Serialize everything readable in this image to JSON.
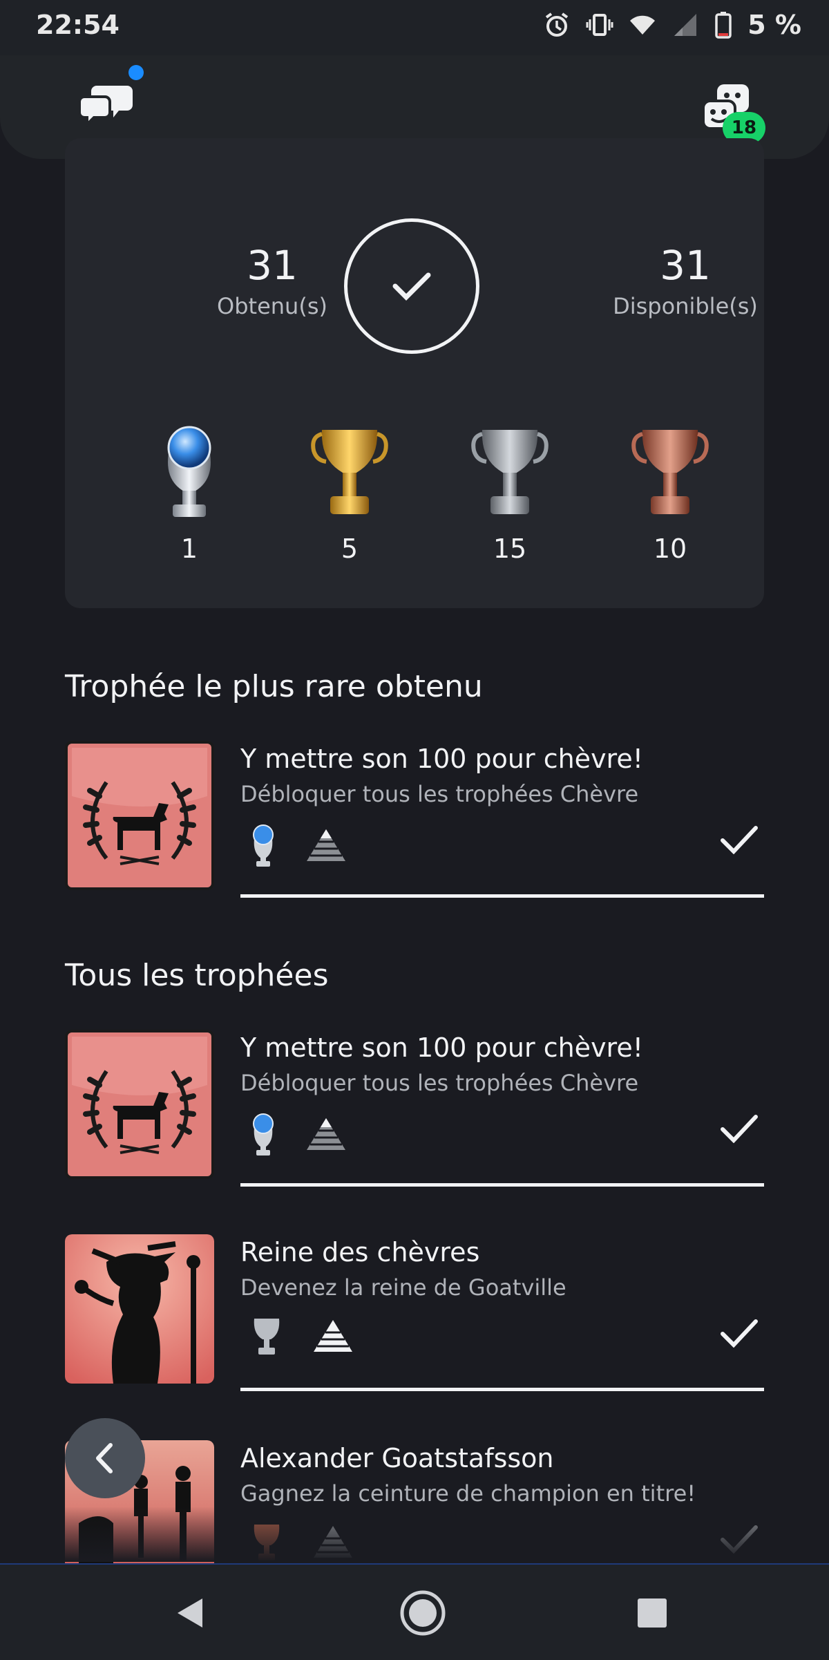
{
  "status_bar": {
    "time": "22:54",
    "battery_percent": "5 %"
  },
  "top_bar": {
    "friends_badge": "18"
  },
  "summary": {
    "earned_count": "31",
    "earned_label": "Obtenu(s)",
    "available_count": "31",
    "available_label": "Disponible(s)",
    "progress": 1.0,
    "trophies": [
      {
        "type": "platinum",
        "count": "1"
      },
      {
        "type": "gold",
        "count": "5"
      },
      {
        "type": "silver",
        "count": "15"
      },
      {
        "type": "bronze",
        "count": "10"
      }
    ]
  },
  "rarest": {
    "section_title": "Trophée le plus rare obtenu",
    "item": {
      "title": "Y mettre son 100 pour chèvre!",
      "description": "Débloquer tous les trophées Chèvre",
      "grade": "platinum",
      "earned": true
    }
  },
  "all_trophies": {
    "section_title": "Tous les trophées",
    "items": [
      {
        "title": "Y mettre son 100 pour chèvre!",
        "description": "Débloquer tous les trophées Chèvre",
        "grade": "platinum",
        "earned": true
      },
      {
        "title": "Reine des chèvres",
        "description": "Devenez la reine de Goatville",
        "grade": "silver",
        "earned": true
      },
      {
        "title": "Alexander Goatstafsson",
        "description": "Gagnez la ceinture de champion en titre!",
        "grade": "bronze",
        "earned": true
      }
    ]
  },
  "colors": {
    "background": "#1a1b21",
    "card": "#25272d",
    "accent_green": "#17d168",
    "notification_blue": "#1a8cff"
  }
}
